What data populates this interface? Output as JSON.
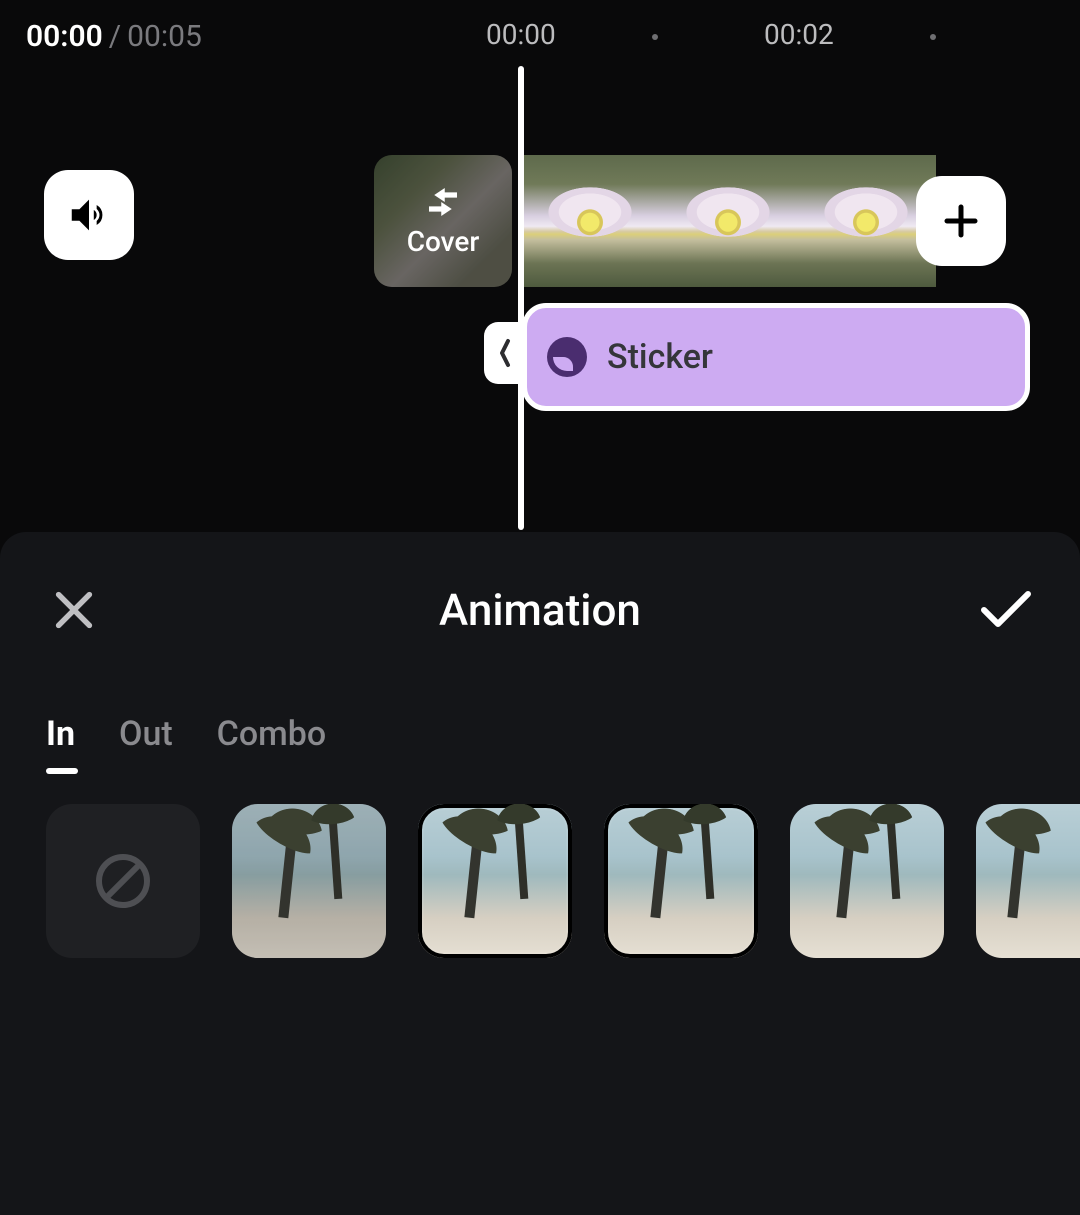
{
  "time": {
    "current": "00:00",
    "duration": "00:05"
  },
  "ruler": {
    "t0": "00:00",
    "t1": "00:02"
  },
  "cover_label": "Cover",
  "sticker_label": "Sticker",
  "sheet": {
    "title": "Animation"
  },
  "tabs": {
    "in": "In",
    "out": "Out",
    "combo": "Combo",
    "active": "in"
  },
  "clip_count": 3,
  "animation_options": [
    "none",
    "preset1",
    "preset2",
    "preset3",
    "preset4",
    "preset5"
  ]
}
